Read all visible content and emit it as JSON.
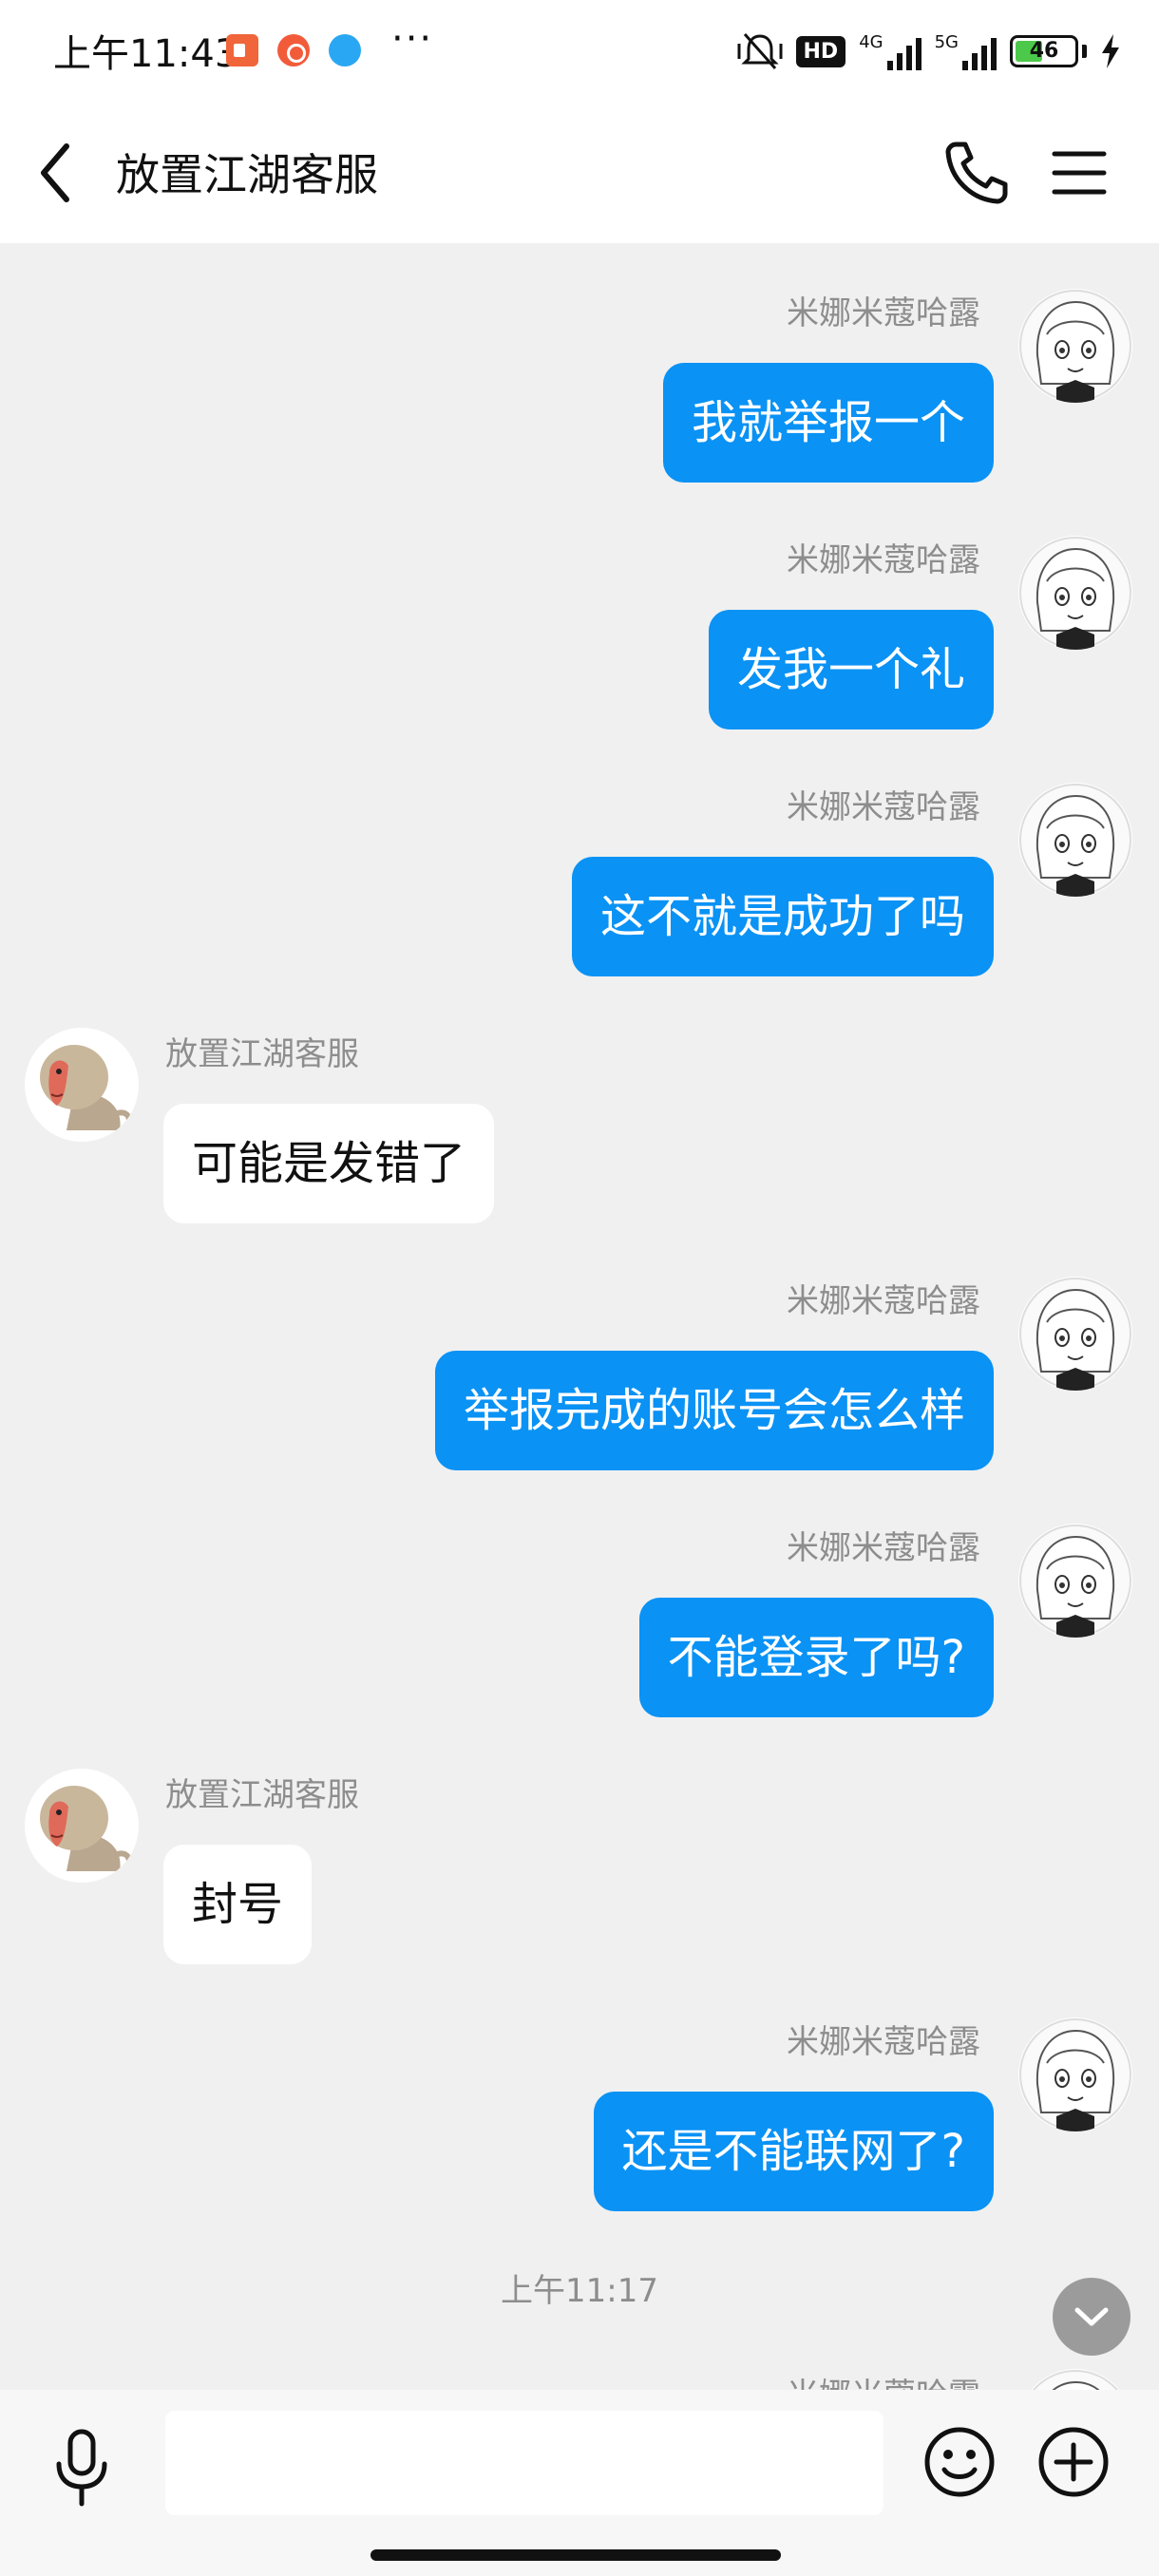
{
  "status_bar": {
    "time": "上午11:43",
    "more": "···",
    "hd": "HD",
    "net1": "4G",
    "net2": "5G",
    "battery": "46",
    "battery_level": 0.46
  },
  "header": {
    "title": "放置江湖客服",
    "back_icon": "chevron-left-icon",
    "call_icon": "phone-icon",
    "menu_icon": "hamburger-menu-icon"
  },
  "messages": [
    {
      "side": "out",
      "sender": "米娜米蔻哈露",
      "text": "我就举报一个"
    },
    {
      "side": "out",
      "sender": "米娜米蔻哈露",
      "text": "发我一个礼"
    },
    {
      "side": "out",
      "sender": "米娜米蔻哈露",
      "text": "这不就是成功了吗"
    },
    {
      "side": "in",
      "sender": "放置江湖客服",
      "text": "可能是发错了"
    },
    {
      "side": "out",
      "sender": "米娜米蔻哈露",
      "text": "举报完成的账号会怎么样"
    },
    {
      "side": "out",
      "sender": "米娜米蔻哈露",
      "text": "不能登录了吗?"
    },
    {
      "side": "in",
      "sender": "放置江湖客服",
      "text": "封号"
    },
    {
      "side": "out",
      "sender": "米娜米蔻哈露",
      "text": "还是不能联网了?"
    }
  ],
  "time_divider": "上午11:17",
  "partial_sender": "米娜米蔻哈露",
  "input_bar": {
    "placeholder": "",
    "voice_icon": "microphone-icon",
    "emoji_icon": "smiley-icon",
    "plus_icon": "plus-circle-icon"
  },
  "colors": {
    "outgoing_bubble": "#0a92f5",
    "incoming_bubble": "#ffffff",
    "chat_background": "#f0f0f0"
  }
}
